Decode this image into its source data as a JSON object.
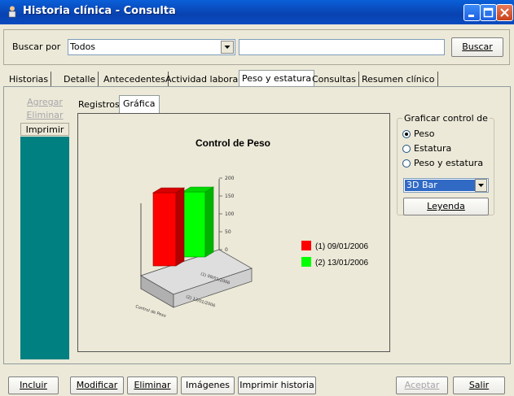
{
  "window": {
    "title": "Historia clínica - Consulta"
  },
  "search": {
    "label": "Buscar por",
    "mode_value": "Todos",
    "query_value": "",
    "button_label": "Buscar"
  },
  "tabs": [
    "Historias",
    "Detalle",
    "Antecedentes",
    "Actividad laboral",
    "Peso y estatura",
    "Consultas",
    "Resumen clínico"
  ],
  "side_actions": {
    "add": "Agregar",
    "delete": "Eliminar",
    "print": "Imprimir"
  },
  "inner_tabs": [
    "Registros",
    "Gráfica"
  ],
  "chart_options": {
    "title": "Graficar control de",
    "options": [
      "Peso",
      "Estatura",
      "Peso y estatura"
    ],
    "selected": "Peso",
    "chart_type": "3D Bar",
    "legend_button": "Leyenda"
  },
  "chart_data": {
    "type": "bar",
    "title": "Control de Peso",
    "categories": [
      "(1) 09/01/2006",
      "(2) 13/01/2006"
    ],
    "values": [
      180,
      160
    ],
    "ylim": [
      0,
      200
    ],
    "ticks": [
      "200",
      "150",
      "100",
      "50",
      "0"
    ],
    "colors": [
      "#ff0000",
      "#00ff00"
    ]
  },
  "bottom_buttons": {
    "include": "Incluir",
    "modify": "Modificar",
    "delete": "Eliminar",
    "images": "Imágenes",
    "print_history": "Imprimir historia",
    "accept": "Aceptar",
    "exit": "Salir"
  }
}
